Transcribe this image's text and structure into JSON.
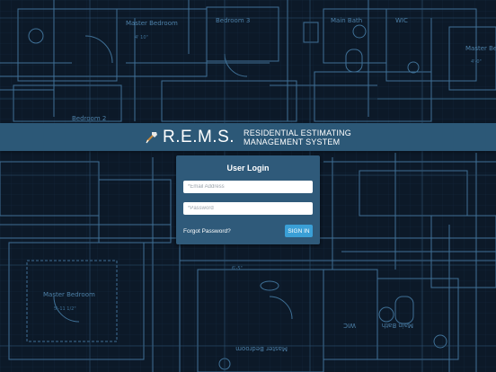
{
  "header": {
    "logo_text": "R.E.M.S.",
    "tagline_line1": "RESIDENTIAL ESTIMATING",
    "tagline_line2": "MANAGEMENT SYSTEM",
    "logo_icon": "hammer-icon"
  },
  "login": {
    "title": "User Login",
    "email_placeholder": "*Email Address",
    "password_placeholder": "*Password",
    "forgot_label": "Forgot Password?",
    "signin_label": "SIGN IN"
  },
  "blueprint": {
    "room_labels": {
      "master_bedroom_top": "Master Bedroom",
      "bedroom_3": "Bedroom 3",
      "main_bath": "Main Bath",
      "wic": "WIC",
      "master_bed_right": "Master Be",
      "bedroom_2": "Bedroom 2",
      "master_bedroom_bottom": "Master Bedroom",
      "master_bedroom_flipped": "Master Bedroom",
      "main_bath_flipped": "Main Bath",
      "wic_flipped": "WIC"
    },
    "dims": {
      "d1": "4' 10\"",
      "d2": "4'-0\"",
      "d3": "5'-11 1/2\"",
      "d4": "6'-5\""
    }
  },
  "colors": {
    "background": "#0d1a2a",
    "banner": "#2c5877",
    "card": "#2f5a7a",
    "button": "#3a9fd6",
    "line": "#3f7096"
  }
}
